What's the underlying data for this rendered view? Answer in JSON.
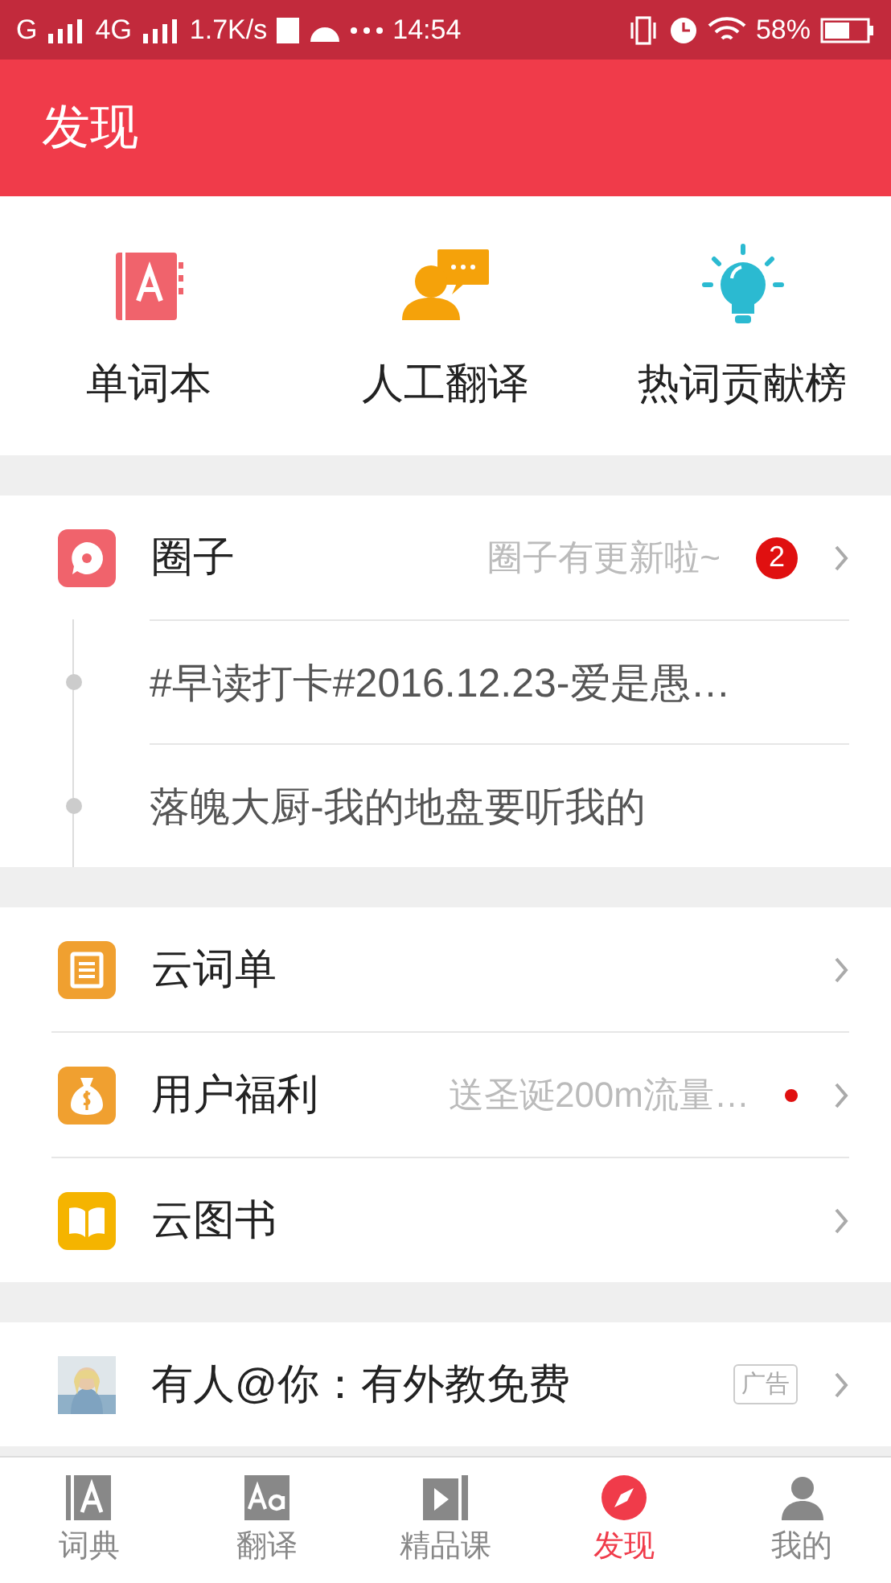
{
  "status_bar": {
    "carrier_1": "G",
    "carrier_2": "4G",
    "speed": "1.7K/s",
    "time": "14:54",
    "battery": "58%"
  },
  "header": {
    "title": "发现"
  },
  "shortcuts": [
    {
      "kind": "notebook",
      "label": "单词本"
    },
    {
      "kind": "translator",
      "label": "人工翻译"
    },
    {
      "kind": "bulb",
      "label": "热词贡献榜"
    }
  ],
  "circle": {
    "title": "圈子",
    "hint": "圈子有更新啦~",
    "badge": "2",
    "posts": [
      "#早读打卡#2016.12.23-爱是愚…",
      "落魄大厨-我的地盘要听我的"
    ]
  },
  "menu": [
    {
      "kind": "list",
      "label": "云词单",
      "new_dot": false
    },
    {
      "kind": "coin",
      "label": "用户福利",
      "hint": "送圣诞200m流量…",
      "new_dot": true
    },
    {
      "kind": "book",
      "label": "云图书",
      "new_dot": false
    }
  ],
  "ad": {
    "title": "有人@你：有外教免费",
    "tag": "广告"
  },
  "bottom_nav": [
    {
      "kind": "dict",
      "label": "词典",
      "selected": false
    },
    {
      "kind": "translate",
      "label": "翻译",
      "selected": false
    },
    {
      "kind": "course",
      "label": "精品课",
      "selected": false
    },
    {
      "kind": "discover",
      "label": "发现",
      "selected": true
    },
    {
      "kind": "me",
      "label": "我的",
      "selected": false
    }
  ]
}
